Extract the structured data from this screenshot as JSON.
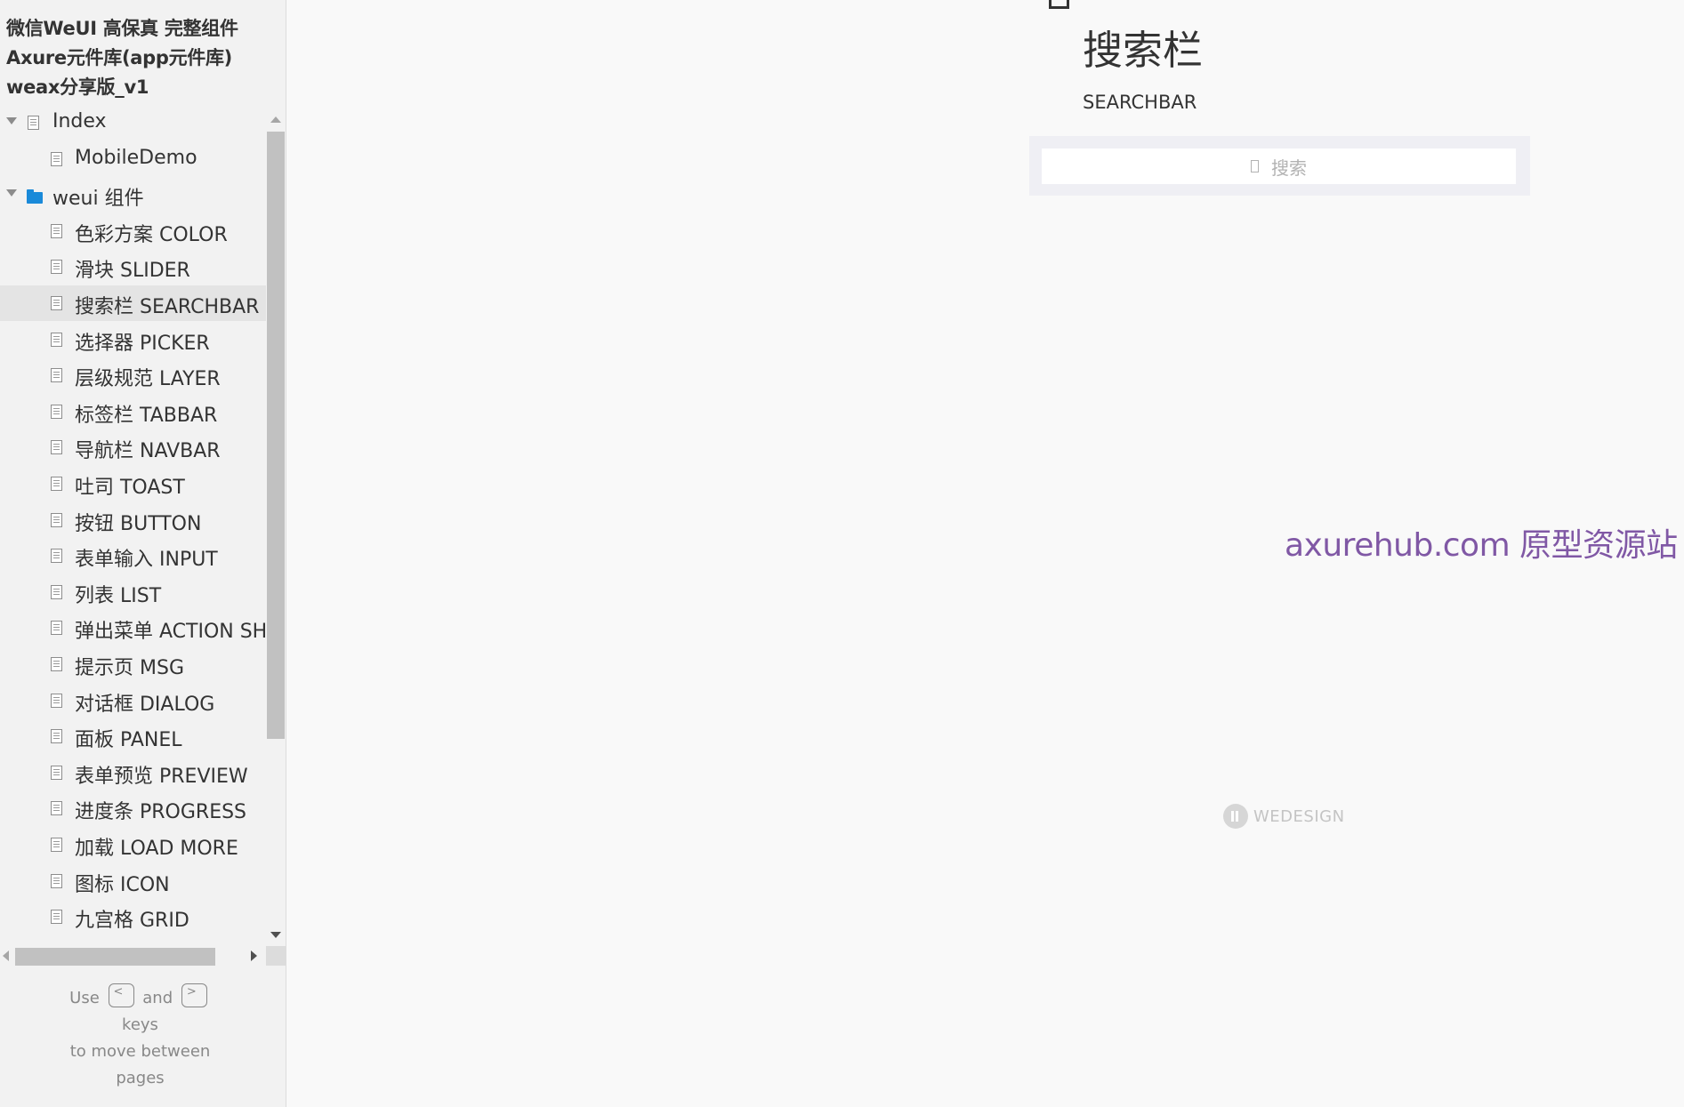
{
  "sidebar": {
    "title_lines": [
      "微信WeUI 高保真 完整组件",
      "Axure元件库(app元件库)",
      "weax分享版_v1"
    ],
    "tree": [
      {
        "label": "Index",
        "kind": "page",
        "expanded": true
      },
      {
        "label": "MobileDemo",
        "kind": "page"
      },
      {
        "label": "weui 组件",
        "kind": "folder",
        "expanded": true
      },
      {
        "label": "色彩方案 COLOR",
        "kind": "page"
      },
      {
        "label": "滑块 SLIDER",
        "kind": "page"
      },
      {
        "label": "搜索栏 SEARCHBAR",
        "kind": "page",
        "selected": true
      },
      {
        "label": "选择器 PICKER",
        "kind": "page"
      },
      {
        "label": "层级规范 LAYER",
        "kind": "page"
      },
      {
        "label": "标签栏 TABBAR",
        "kind": "page"
      },
      {
        "label": "导航栏 NAVBAR",
        "kind": "page"
      },
      {
        "label": "吐司 TOAST",
        "kind": "page"
      },
      {
        "label": "按钮 BUTTON",
        "kind": "page"
      },
      {
        "label": "表单输入 INPUT",
        "kind": "page"
      },
      {
        "label": "列表 LIST",
        "kind": "page"
      },
      {
        "label": "弹出菜单 ACTION SHEET",
        "kind": "page"
      },
      {
        "label": "提示页 MSG",
        "kind": "page"
      },
      {
        "label": "对话框 DIALOG",
        "kind": "page"
      },
      {
        "label": "面板 PANEL",
        "kind": "page"
      },
      {
        "label": "表单预览 PREVIEW",
        "kind": "page"
      },
      {
        "label": "进度条 PROGRESS",
        "kind": "page"
      },
      {
        "label": "加载 LOAD MORE",
        "kind": "page"
      },
      {
        "label": "图标 ICON",
        "kind": "page"
      },
      {
        "label": "九宫格 GRID",
        "kind": "page"
      }
    ],
    "hint": {
      "use": "Use",
      "key_prev": "<",
      "and": "and",
      "key_next": ">",
      "keys": "keys",
      "line2": "to move between",
      "line3": "pages"
    }
  },
  "main": {
    "heading": "搜索栏",
    "subheading": "SEARCHBAR",
    "search": {
      "placeholder": "搜索",
      "icon": "search-icon"
    },
    "watermark": "axurehub.com 原型资源站",
    "footer_brand": "WEDESIGN"
  },
  "colors": {
    "folder": "#1a8ad9",
    "watermark": "#8058a5",
    "sidebar_bg": "#f2f2f2",
    "selected_row": "#e4e4e4",
    "search_bg": "#efeff4"
  }
}
